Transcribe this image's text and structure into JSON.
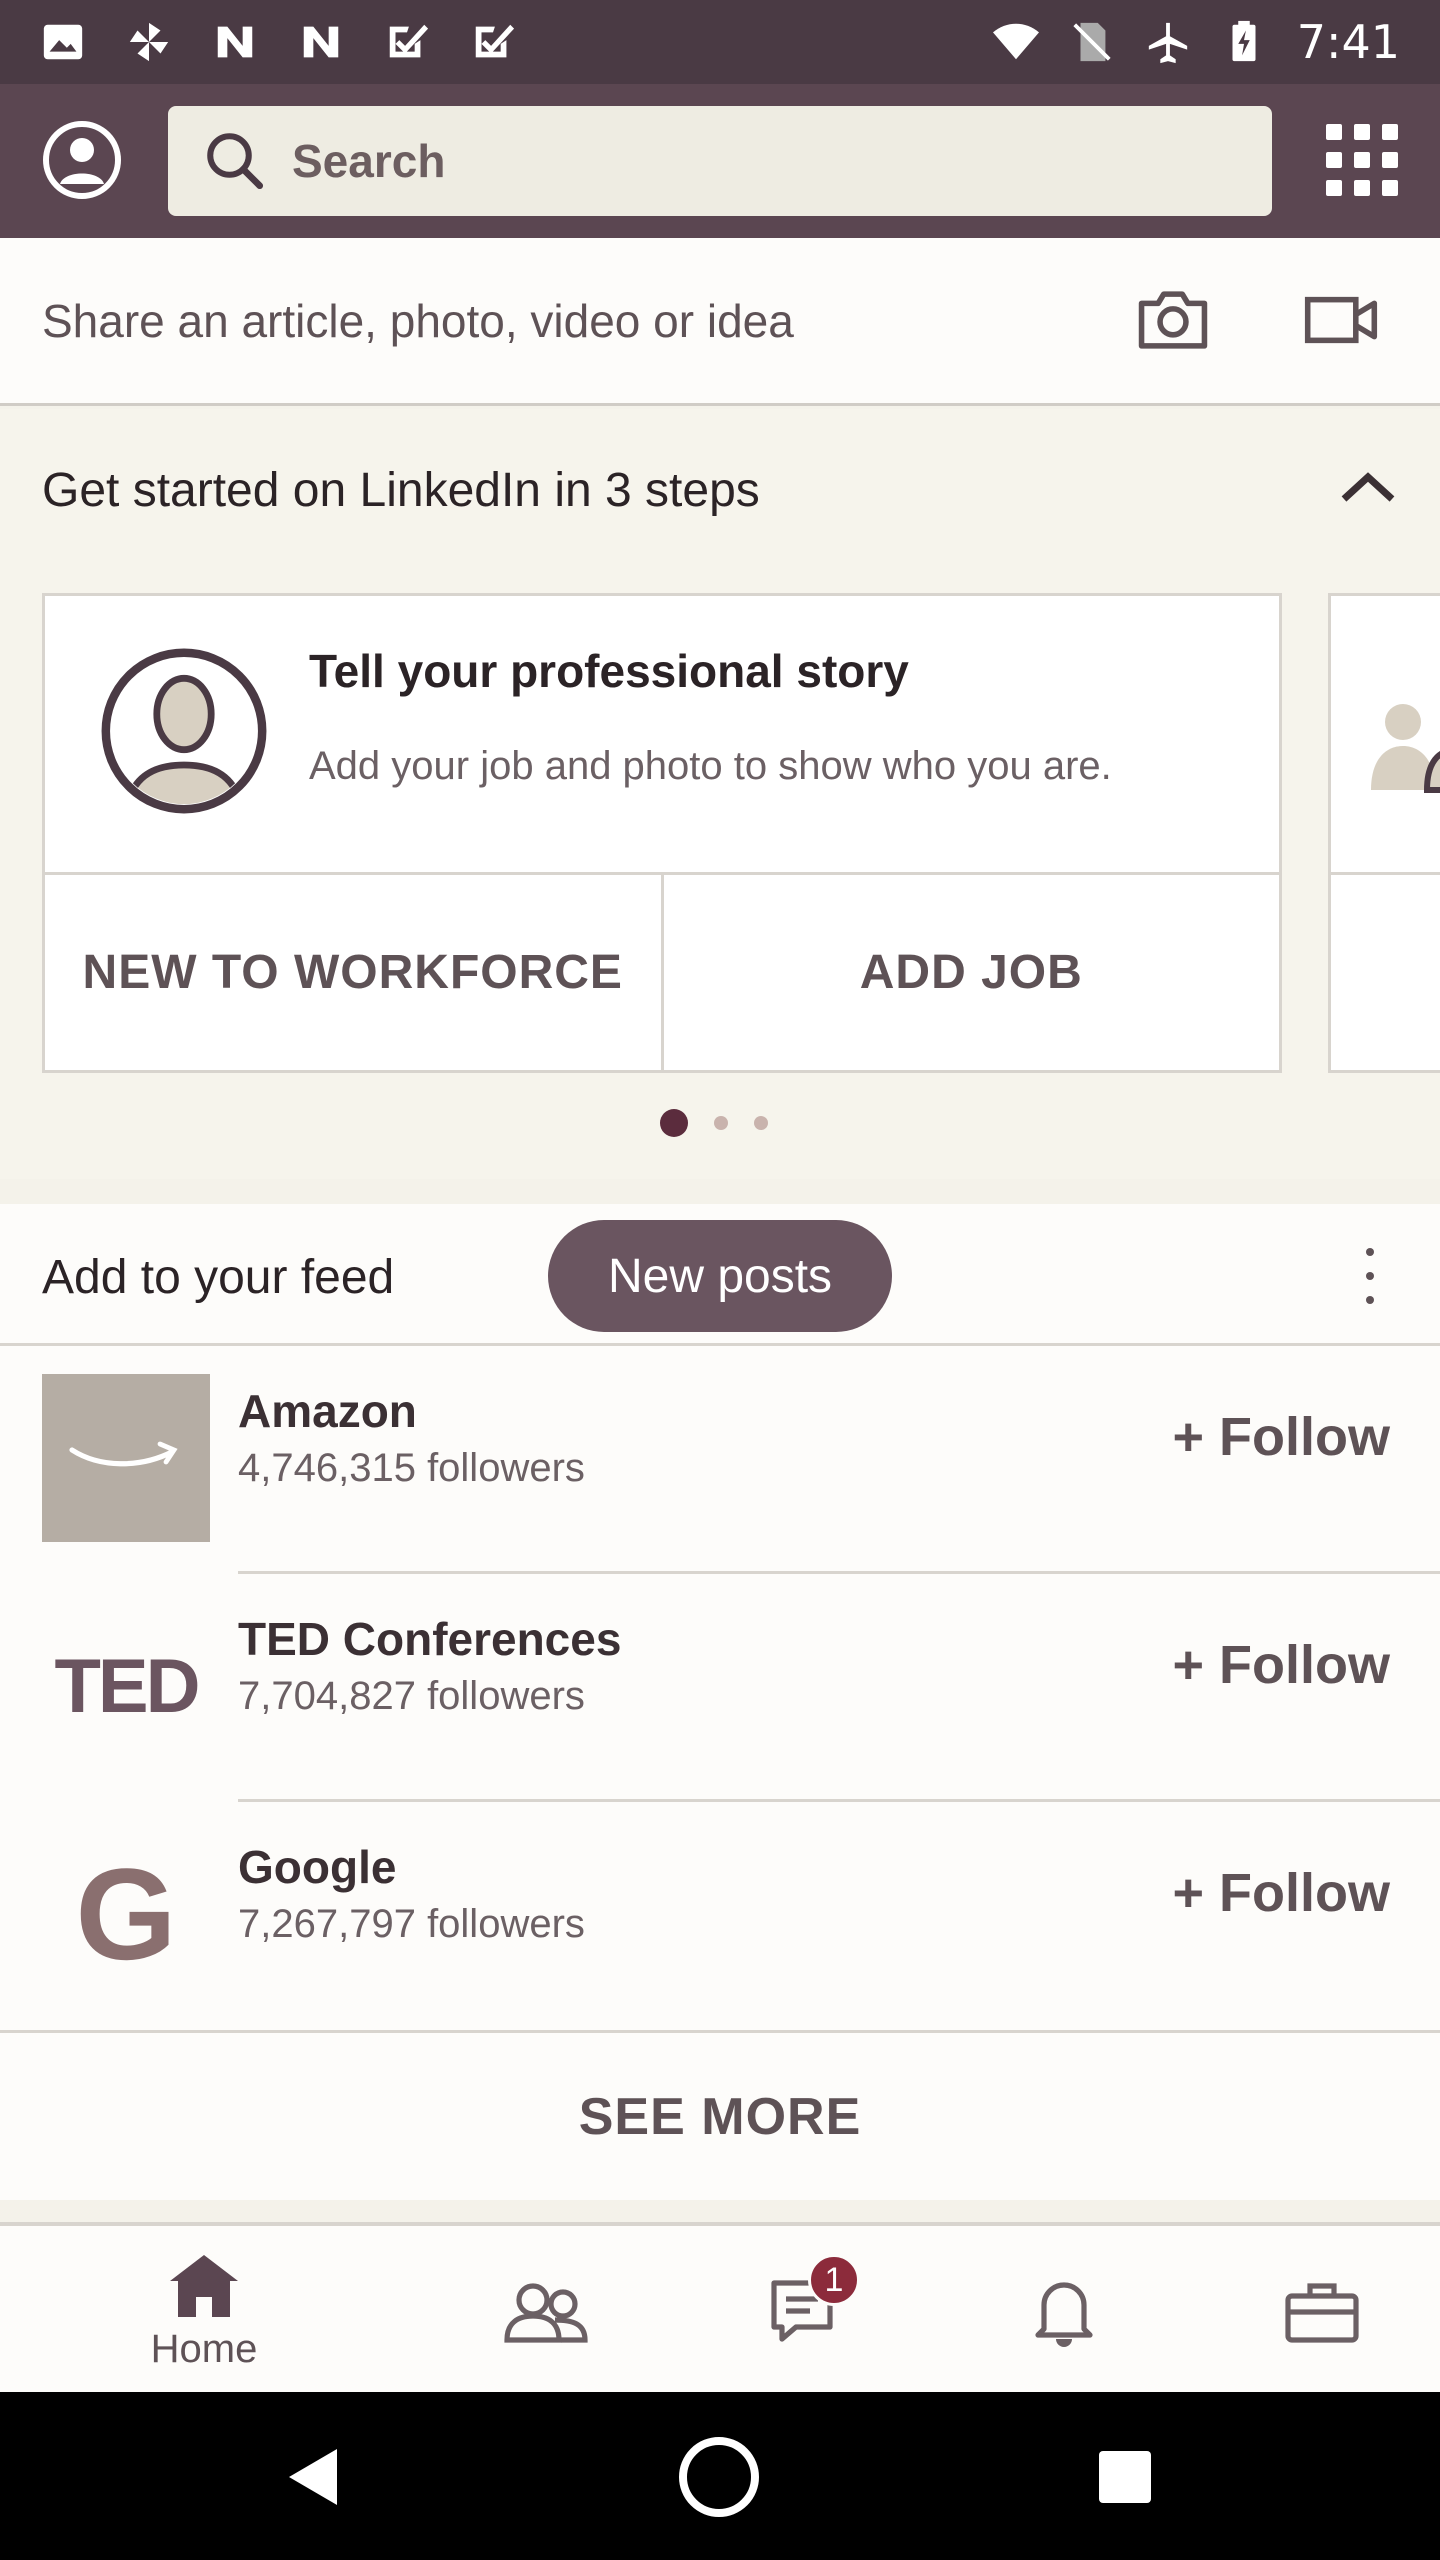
{
  "status_bar": {
    "time": "7:41",
    "left_icons": [
      "image-icon",
      "pinwheel-icon",
      "n-icon",
      "n-icon",
      "check-icon",
      "check-icon"
    ],
    "right_icons": [
      "wifi-icon",
      "no-sim-icon",
      "airplane-icon",
      "battery-icon"
    ]
  },
  "top_bar": {
    "search_placeholder": "Search",
    "icons": [
      "profile-icon",
      "search-icon",
      "apps-grid-icon"
    ]
  },
  "share": {
    "prompt": "Share an article, photo, video or idea",
    "icons": [
      "camera-icon",
      "video-icon"
    ]
  },
  "get_started": {
    "title": "Get started on LinkedIn in 3 steps",
    "card": {
      "title": "Tell your professional story",
      "description": "Add your job and photo to show who you are.",
      "button_left": "NEW TO WORKFORCE",
      "button_right": "ADD JOB"
    },
    "page_count": 3,
    "current_page": 1
  },
  "feed": {
    "title": "Add to your feed",
    "new_posts_label": "New posts",
    "companies": [
      {
        "name": "Amazon",
        "followers": "4,746,315 followers",
        "follow_label": "+ Follow"
      },
      {
        "name": "TED Conferences",
        "followers": "7,704,827 followers",
        "follow_label": "+ Follow",
        "logo_text": "TED"
      },
      {
        "name": "Google",
        "followers": "7,267,797 followers",
        "follow_label": "+ Follow",
        "logo_text": "G"
      }
    ],
    "see_more_label": "SEE MORE"
  },
  "bottom_nav": {
    "items": [
      {
        "label": "Home",
        "icon": "home-icon",
        "active": true
      },
      {
        "label": "",
        "icon": "network-icon"
      },
      {
        "label": "",
        "icon": "messaging-icon",
        "badge": "1"
      },
      {
        "label": "",
        "icon": "notifications-icon"
      },
      {
        "label": "",
        "icon": "jobs-icon"
      }
    ]
  },
  "colors": {
    "top_bar": "#5b4651",
    "accent": "#5b2c3d",
    "badge": "#8c2b3b"
  }
}
